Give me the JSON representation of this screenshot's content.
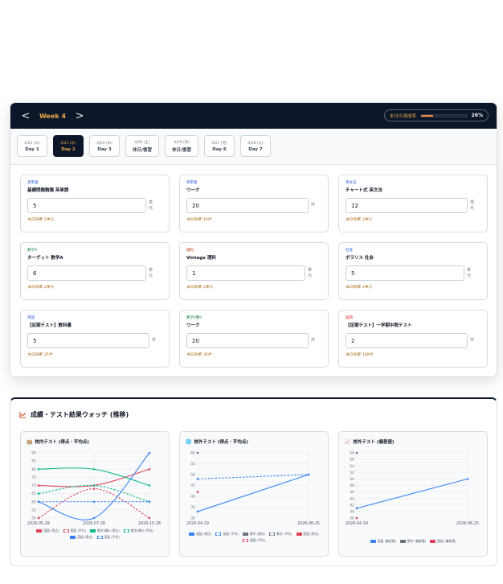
{
  "week": {
    "prev": "<",
    "title": "Week 4",
    "next": ">"
  },
  "achievement": {
    "label": "本日の達成率",
    "value": "26%",
    "fraction": 0.26,
    "color": "#f08a3c"
  },
  "days": [
    {
      "date": "4/22 (火)",
      "label": "Day 1",
      "active": false
    },
    {
      "date": "4/23 (水)",
      "label": "Day 2",
      "active": true
    },
    {
      "date": "4/24 (木)",
      "label": "Day 3",
      "active": false
    },
    {
      "date": "4/25 (土)",
      "label": "休日/復習",
      "active": false
    },
    {
      "date": "4/26 (日)",
      "label": "休日/復習",
      "active": false
    },
    {
      "date": "4/27 (月)",
      "label": "Day 6",
      "active": false
    },
    {
      "date": "4/28 (火)",
      "label": "Day 7",
      "active": false
    }
  ],
  "tasks": [
    {
      "subject": "英単語",
      "subject_color": "#1d4ed8",
      "name": "基礎問題精講 英単語",
      "value": "5",
      "unit": "単元",
      "target": "本日目標: 2単元"
    },
    {
      "subject": "英単語",
      "subject_color": "#1d4ed8",
      "name": "ワーク",
      "value": "20",
      "unit": "件",
      "target": "本日目標: 10件"
    },
    {
      "subject": "英文法",
      "subject_color": "#1d4ed8",
      "name": "チャート式 英文法",
      "value": "12",
      "unit": "単元",
      "target": "本日目標: 2単元"
    },
    {
      "subject": "数学A",
      "subject_color": "#15803d",
      "name": "ターゲット 数学A",
      "value": "6",
      "unit": "単元",
      "target": "本日目標: 2単元"
    },
    {
      "subject": "理科",
      "subject_color": "#c2410c",
      "name": "Vintage 理科",
      "value": "1",
      "unit": "単元",
      "target": "本日目標: 3単元"
    },
    {
      "subject": "社会",
      "subject_color": "#1d4ed8",
      "name": "ボラリス 社会",
      "value": "5",
      "unit": "単元",
      "target": "本日目標: 2単元"
    },
    {
      "subject": "英語",
      "subject_color": "#1d4ed8",
      "name": "【定期テスト】教科書",
      "value": "5",
      "unit": "件",
      "target": "本日目標: 25件"
    },
    {
      "subject": "数学I/数II",
      "subject_color": "#15803d",
      "name": "ワーク",
      "value": "20",
      "unit": "件",
      "target": "本日目標: 30件"
    },
    {
      "subject": "国語",
      "subject_color": "#dc2626",
      "name": "【定期テスト】一学期中間テスト",
      "value": "2",
      "unit": "件",
      "target": "本日目標: 100件"
    }
  ],
  "results": {
    "title": "成績・テスト結果ウォッチ (推移)"
  },
  "chart_data": [
    {
      "type": "line",
      "title": "校内テスト (得点・平均点)",
      "x": [
        "2026-05-28",
        "2026-07-28",
        "2026-10-28"
      ],
      "ylim": [
        50,
        90
      ],
      "yticks": [
        50,
        55,
        60,
        65,
        70,
        75,
        80,
        85,
        90
      ],
      "grid": true,
      "legend": "bottom",
      "series": [
        {
          "name": "国語 (得点)",
          "color": "#e0435a",
          "dashed": false,
          "values": [
            70,
            70,
            80
          ]
        },
        {
          "name": "国語 (平均)",
          "color": "#e0435a",
          "dashed": true,
          "values": [
            50,
            68,
            50
          ]
        },
        {
          "name": "数学I/数II (得点)",
          "color": "#10b981",
          "dashed": false,
          "values": [
            80,
            80,
            70
          ]
        },
        {
          "name": "数学I/数II (平均)",
          "color": "#10b981",
          "dashed": true,
          "values": [
            65,
            70,
            60
          ]
        },
        {
          "name": "英語 (得点)",
          "color": "#3b82f6",
          "dashed": false,
          "values": [
            60,
            50,
            90
          ]
        },
        {
          "name": "英語 (平均)",
          "color": "#3b82f6",
          "dashed": true,
          "values": [
            60,
            60,
            60
          ]
        }
      ]
    },
    {
      "type": "line",
      "title": "校外テスト (得点・平均点)",
      "x": [
        "2026-04-19",
        "2026-06-25"
      ],
      "ylim": [
        30,
        60
      ],
      "yticks": [
        30,
        35,
        40,
        45,
        50,
        55,
        60
      ],
      "grid": true,
      "legend": "bottom",
      "series": [
        {
          "name": "英語 (得点)",
          "color": "#3b82f6",
          "dashed": false,
          "values": [
            33,
            50
          ]
        },
        {
          "name": "英語 (平均)",
          "color": "#3b82f6",
          "dashed": true,
          "values": [
            48,
            50
          ]
        },
        {
          "name": "数学 (得点)",
          "color": "#6b7280",
          "dashed": false,
          "values": [
            60,
            null
          ]
        },
        {
          "name": "数学 (平均)",
          "color": "#6b7280",
          "dashed": true,
          "values": [
            null,
            null
          ]
        },
        {
          "name": "国語 (得点)",
          "color": "#e0435a",
          "dashed": false,
          "values": [
            42,
            null
          ]
        },
        {
          "name": "国語 (平均)",
          "color": "#e0435a",
          "dashed": true,
          "values": [
            null,
            null
          ]
        }
      ]
    },
    {
      "type": "line",
      "title": "校外テスト (偏差値)",
      "x": [
        "2026-04-19",
        "2026-06-25"
      ],
      "ylim": [
        38,
        58
      ],
      "yticks": [
        38,
        40,
        42,
        44,
        46,
        48,
        50,
        52,
        54,
        56,
        58
      ],
      "grid": true,
      "legend": "bottom",
      "series": [
        {
          "name": "英語 (偏差値)",
          "color": "#3b82f6",
          "dashed": false,
          "values": [
            41,
            50
          ]
        },
        {
          "name": "数学 (偏差値)",
          "color": "#6b7280",
          "dashed": false,
          "values": [
            58,
            null
          ]
        },
        {
          "name": "国語 (偏差値)",
          "color": "#e0435a",
          "dashed": false,
          "values": [
            38,
            null
          ]
        }
      ]
    }
  ]
}
